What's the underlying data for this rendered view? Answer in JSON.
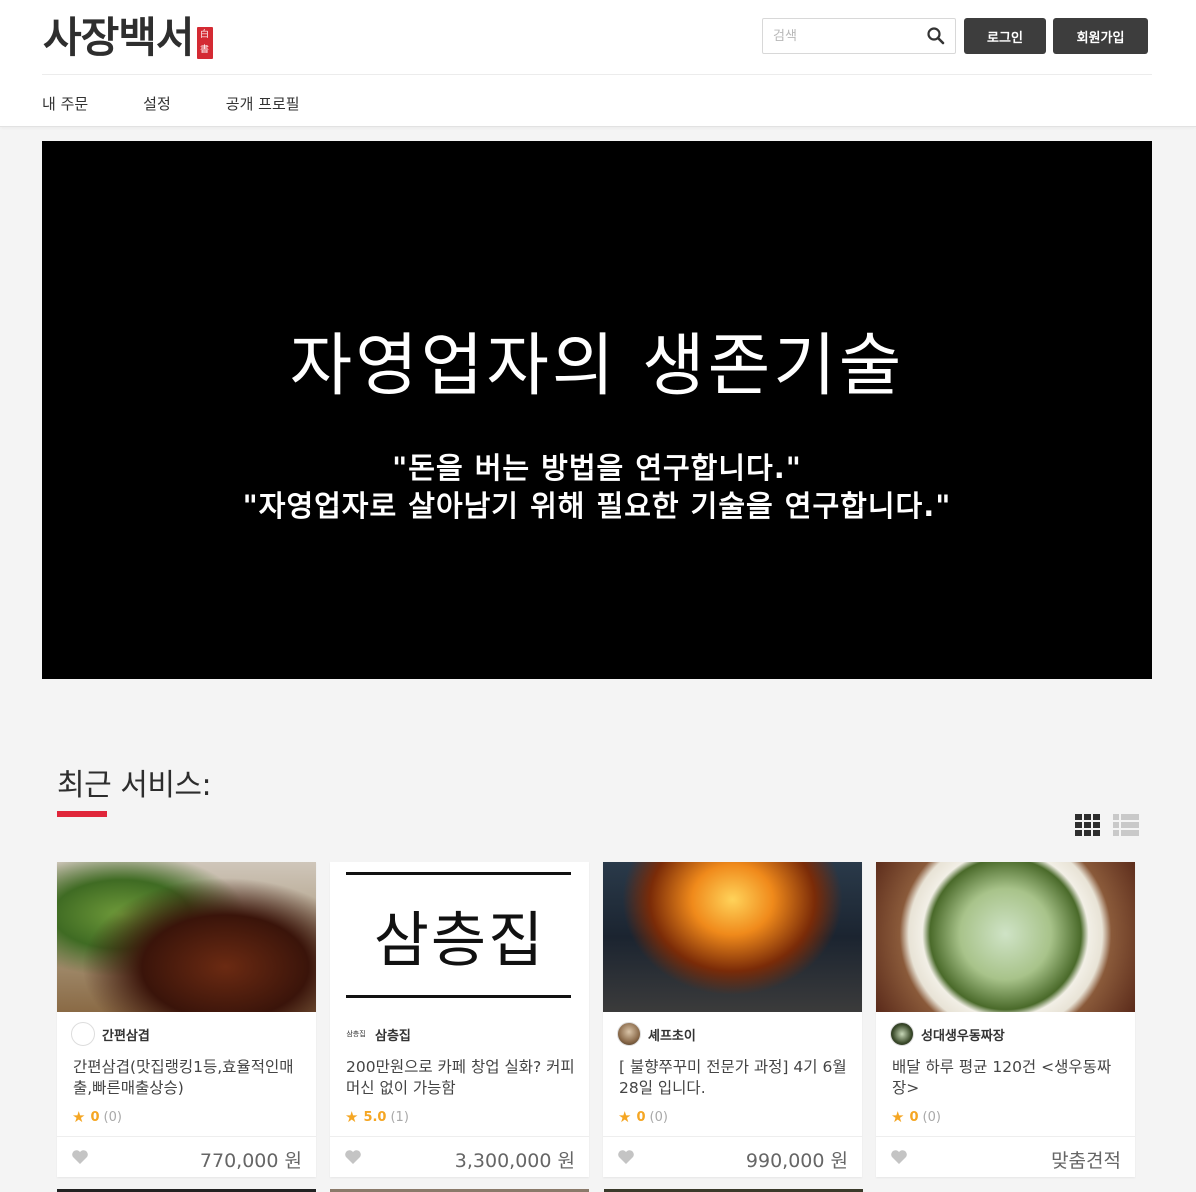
{
  "header": {
    "logo_text": "사장백서",
    "logo_seal": "白書",
    "search_placeholder": "검색",
    "login_label": "로그인",
    "signup_label": "회원가입"
  },
  "nav": {
    "items": [
      {
        "label": "내 주문"
      },
      {
        "label": "설정"
      },
      {
        "label": "공개 프로필"
      }
    ]
  },
  "banner": {
    "title": "자영업자의 생존기술",
    "line1": "\"돈을 버는 방법을 연구합니다.\"",
    "line2": "\"자영업자로 살아남기 위해 필요한 기술을 연구합니다.\""
  },
  "section": {
    "title": "최근 서비스:"
  },
  "cards": [
    {
      "seller": "간편삼겹",
      "title": "간편삼겹(맛집랭킹1등,효율적인매출,빠른매출상승)",
      "rating": "0",
      "count": "(0)",
      "price": "770,000 원",
      "avatar_text": ""
    },
    {
      "seller": "삼층집",
      "title": "200만원으로 카페 창업 실화? 커피머신 없이 가능함",
      "rating": "5.0",
      "count": "(1)",
      "price": "3,300,000 원",
      "avatar_text": "삼층집",
      "image_text": "삼층집"
    },
    {
      "seller": "셰프초이",
      "title": "[ 불향쭈꾸미 전문가 과정] 4기 6월 28일 입니다.",
      "rating": "0",
      "count": "(0)",
      "price": "990,000 원",
      "avatar_text": ""
    },
    {
      "seller": "성대생우동짜장",
      "title": "배달 하루 평균 120건 <생우동짜장>",
      "rating": "0",
      "count": "(0)",
      "price": "맞춤견적",
      "avatar_text": ""
    }
  ],
  "colors": {
    "accent": "#e0263a",
    "star": "#f5a623",
    "button_dark": "#3d3d3d"
  }
}
